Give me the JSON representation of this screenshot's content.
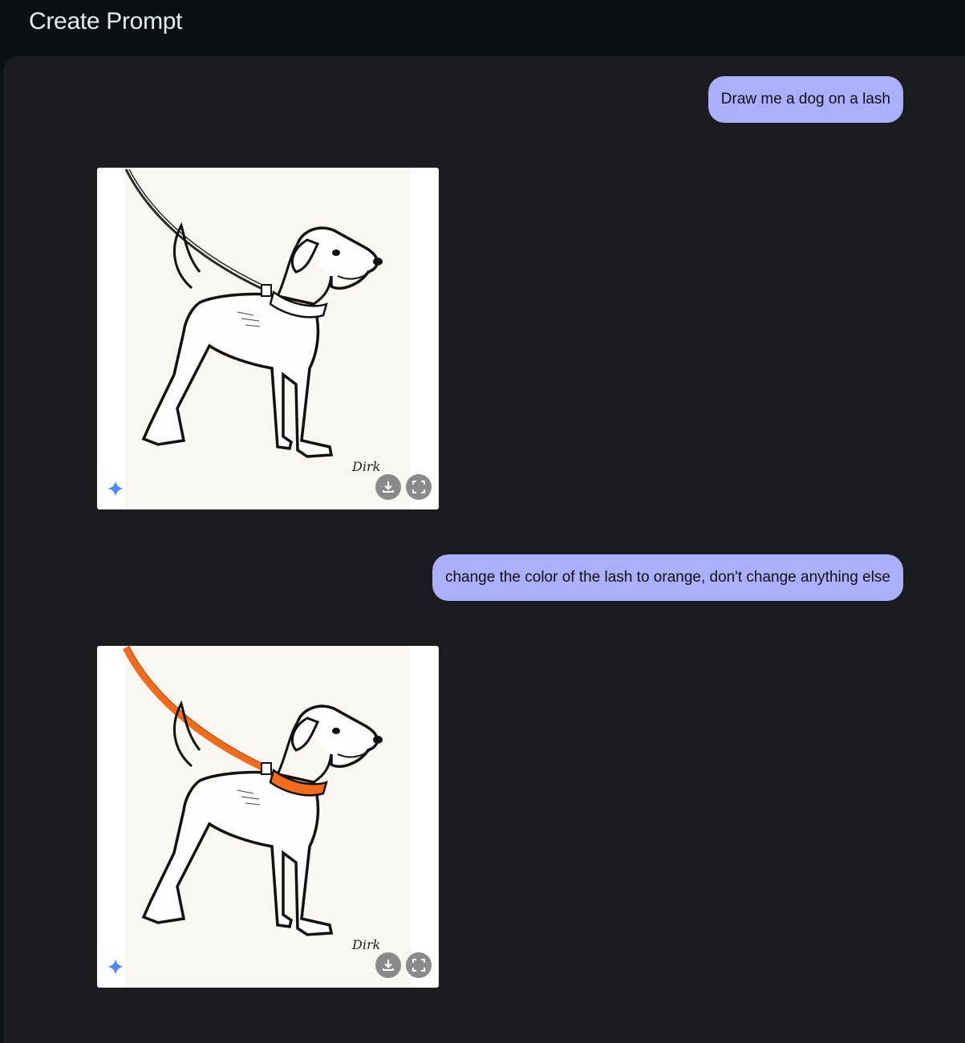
{
  "header": {
    "title": "Create Prompt"
  },
  "messages": [
    {
      "role": "user",
      "text": "Draw me a dog on a lash"
    },
    {
      "role": "model",
      "image": "dog-line-drawing",
      "leash_color": "#2a2a2a",
      "collar_fill": "#ffffff"
    },
    {
      "role": "user",
      "text": "change the color of the lash to orange, don't change anything else"
    },
    {
      "role": "model",
      "image": "dog-line-drawing-orange-leash",
      "leash_color": "#f26b1d",
      "collar_fill": "#f26b1d"
    }
  ],
  "image_actions": {
    "download": "download-icon",
    "fullscreen": "fullscreen-icon"
  },
  "colors": {
    "bubble": "#aab0fb",
    "panel": "#1a1c20",
    "header": "#0c0f14",
    "sparkle": "#4a8af4"
  }
}
